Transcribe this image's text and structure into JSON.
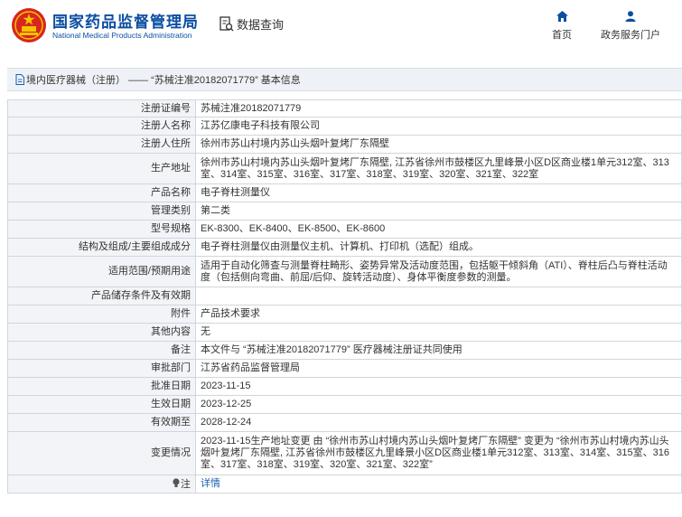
{
  "header": {
    "org_name_cn": "国家药品监督管理局",
    "org_name_en": "National Medical Products Administration",
    "query_label": "数据查询",
    "nav": [
      {
        "label": "首页",
        "icon": "home-icon"
      },
      {
        "label": "政务服务门户",
        "icon": "user-icon"
      }
    ]
  },
  "breadcrumb": "境内医疗器械（注册） —— “苏械注准20182071779” 基本信息",
  "colors": {
    "brand": "#0b4ea2",
    "logo_red": "#d7261e",
    "label_bg": "#f2f4f7",
    "link": "#1a5fb4"
  },
  "table": {
    "rows": [
      {
        "label": "注册证编号",
        "value": "苏械注准20182071779"
      },
      {
        "label": "注册人名称",
        "value": "江苏亿康电子科技有限公司"
      },
      {
        "label": "注册人住所",
        "value": "徐州市苏山村境内苏山头烟叶复烤厂东隔壁"
      },
      {
        "label": "生产地址",
        "value": "徐州市苏山村境内苏山头烟叶复烤厂东隔壁, 江苏省徐州市鼓楼区九里峰景小区D区商业楼1单元312室、313室、314室、315室、316室、317室、318室、319室、320室、321室、322室"
      },
      {
        "label": "产品名称",
        "value": "电子脊柱测量仪"
      },
      {
        "label": "管理类别",
        "value": "第二类"
      },
      {
        "label": "型号规格",
        "value": "EK-8300、EK-8400、EK-8500、EK-8600"
      },
      {
        "label": "结构及组成/主要组成成分",
        "value": "电子脊柱测量仪由测量仪主机、计算机、打印机（选配）组成。"
      },
      {
        "label": "适用范围/预期用途",
        "value": "适用于自动化筛查与测量脊柱畸形、姿势异常及活动度范围，包括躯干倾斜角（ATI）、脊柱后凸与脊柱活动度（包括侧向弯曲、前屈/后仰、旋转活动度）、身体平衡度参数的测量。"
      },
      {
        "label": "产品储存条件及有效期",
        "value": ""
      },
      {
        "label": "附件",
        "value": "产品技术要求"
      },
      {
        "label": "其他内容",
        "value": "无"
      },
      {
        "label": "备注",
        "value": "本文件与 “苏械注准20182071779” 医疗器械注册证共同使用"
      },
      {
        "label": "审批部门",
        "value": "江苏省药品监督管理局"
      },
      {
        "label": "批准日期",
        "value": "2023-11-15"
      },
      {
        "label": "生效日期",
        "value": "2023-12-25"
      },
      {
        "label": "有效期至",
        "value": "2028-12-24"
      },
      {
        "label": "变更情况",
        "value": "2023-11-15生产地址变更 由 “徐州市苏山村境内苏山头烟叶复烤厂东隔壁” 变更为 “徐州市苏山村境内苏山头烟叶复烤厂东隔壁, 江苏省徐州市鼓楼区九里峰景小区D区商业楼1单元312室、313室、314室、315室、316室、317室、318室、319室、320室、321室、322室”"
      }
    ],
    "note": {
      "label": "注",
      "icon": "bulb-icon",
      "value": "详情"
    }
  }
}
